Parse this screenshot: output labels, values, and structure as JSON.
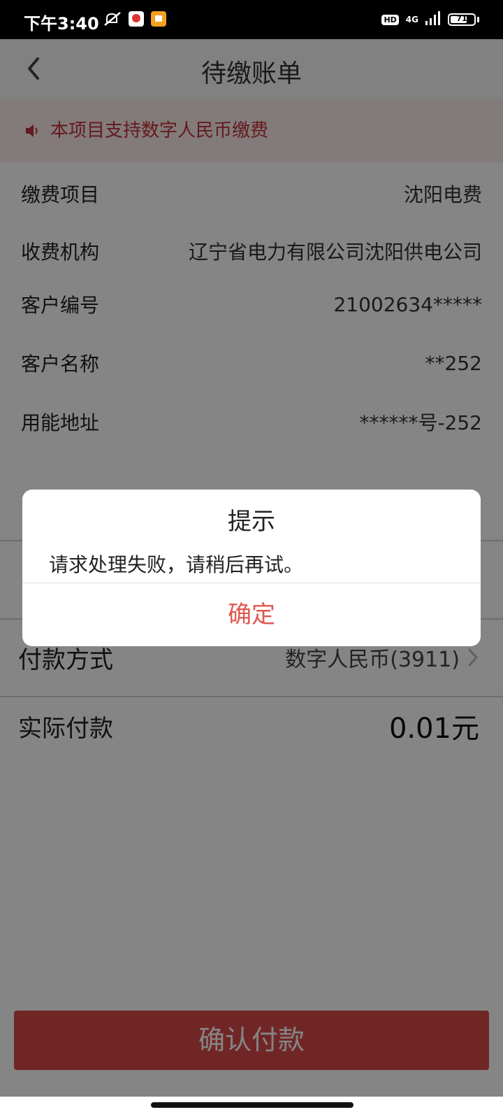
{
  "status_bar": {
    "time": "下午3:40",
    "hd": "HD",
    "network": "4G",
    "battery": "71",
    "battery_level": 0.71
  },
  "header": {
    "title": "待缴账单"
  },
  "notice": {
    "text": "本项目支持数字人民币缴费"
  },
  "info": {
    "rows": [
      {
        "label": "缴费项目",
        "value": "沈阳电费"
      },
      {
        "label": "收费机构",
        "value": "辽宁省电力有限公司沈阳供电公司"
      },
      {
        "label": "客户编号",
        "value": "21002634*****"
      },
      {
        "label": "客户名称",
        "value": "**252"
      },
      {
        "label": "用能地址",
        "value": "******号-252"
      }
    ]
  },
  "payment": {
    "method_label": "付款方式",
    "method_value": "数字人民币(3911)",
    "actual_label": "实际付款",
    "actual_value": "0.01元"
  },
  "confirm_button": "确认付款",
  "dialog": {
    "title": "提示",
    "message": "请求处理失败，请稍后再试。",
    "ok": "确定"
  },
  "colors": {
    "accent_red": "#d94a4a",
    "notice_text": "#c0333a",
    "dialog_button": "#e0584f"
  }
}
